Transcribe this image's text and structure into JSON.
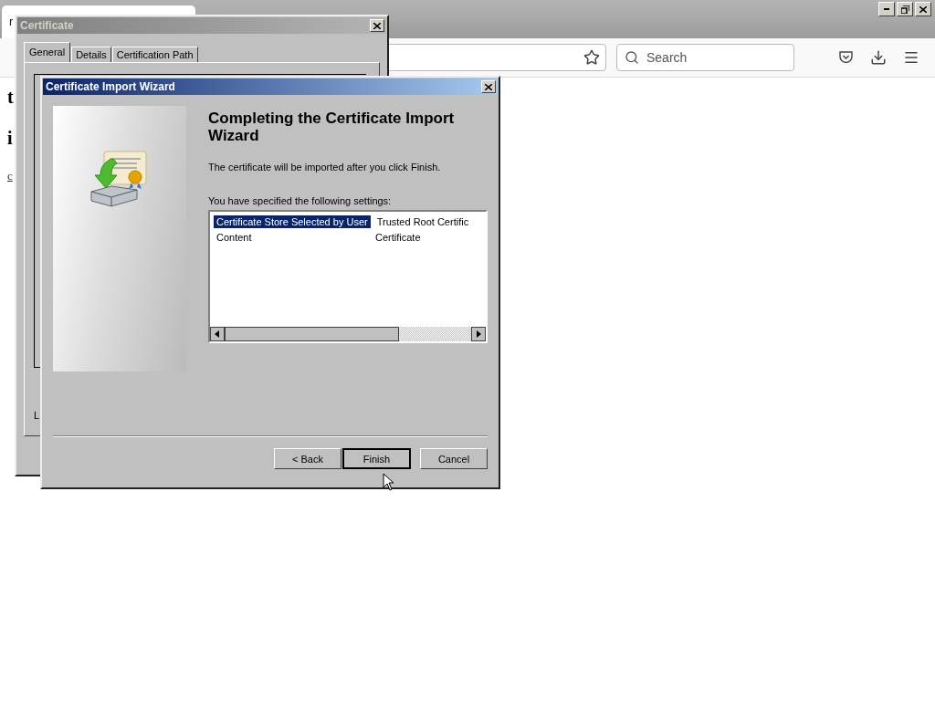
{
  "browser": {
    "tab_title": "r",
    "search": {
      "placeholder": "Search"
    },
    "page_lines": [
      {
        "text": "t",
        "kind": "heading"
      },
      {
        "text": "i",
        "kind": "heading"
      },
      {
        "text": "c",
        "kind": "link"
      }
    ]
  },
  "certificate_window": {
    "title": "Certificate",
    "active": false,
    "tabs": [
      {
        "label": "General",
        "selected": true
      },
      {
        "label": "Details",
        "selected": false
      },
      {
        "label": "Certification Path",
        "selected": false
      }
    ],
    "footer_text": "L"
  },
  "wizard": {
    "title": "Certificate Import Wizard",
    "active": true,
    "heading": "Completing the Certificate Import Wizard",
    "message": "The certificate will be imported after you click Finish.",
    "settings_label": "You have specified the following settings:",
    "settings": [
      {
        "name": "Certificate Store Selected by User",
        "value": "Trusted Root Certific",
        "selected": true
      },
      {
        "name": "Content",
        "value": "Certificate",
        "selected": false
      }
    ],
    "buttons": [
      {
        "label": "< Back",
        "default": false
      },
      {
        "label": "Finish",
        "default": true
      },
      {
        "label": "Cancel",
        "default": false
      }
    ]
  }
}
